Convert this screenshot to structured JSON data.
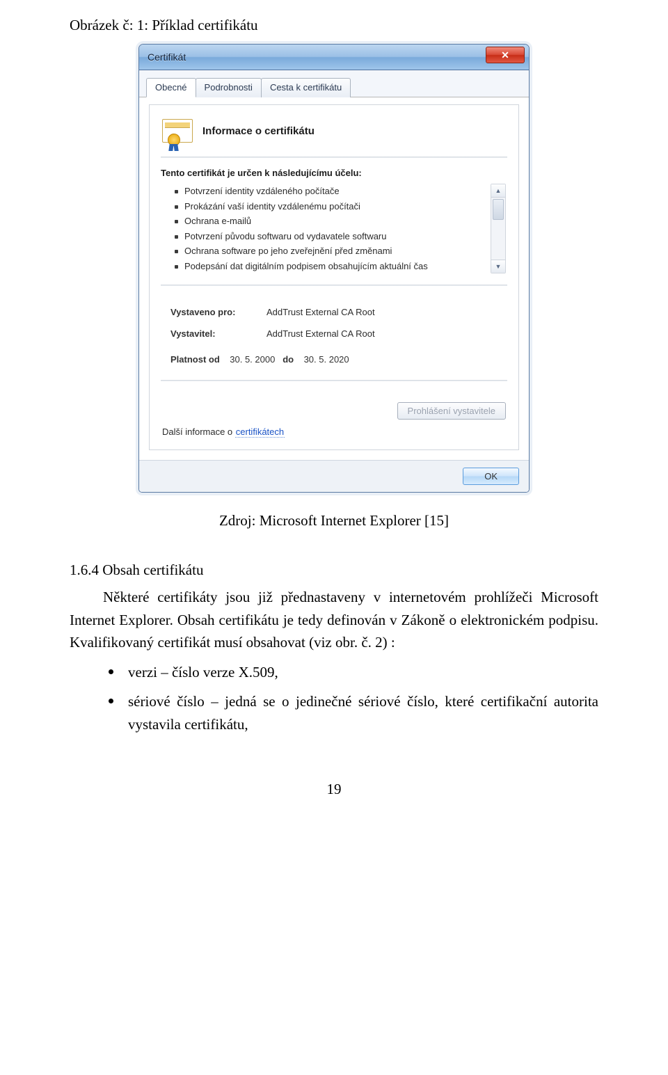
{
  "figure_caption": "Obrázek č: 1: Příklad certifikátu",
  "window": {
    "title": "Certifikát",
    "tabs": [
      "Obecné",
      "Podrobnosti",
      "Cesta k certifikátu"
    ],
    "cert_info_heading": "Informace o certifikátu",
    "purpose_heading": "Tento certifikát je určen k následujícímu účelu:",
    "purposes": [
      "Potvrzení identity vzdáleného počítače",
      "Prokázání vaší identity vzdálenému počítači",
      "Ochrana e-mailů",
      "Potvrzení původu softwaru od vydavatele softwaru",
      "Ochrana software po jeho zveřejnění před změnami",
      "Podepsání dat digitálním podpisem obsahujícím aktuální čas"
    ],
    "issued_to_label": "Vystaveno pro:",
    "issued_to_value": "AddTrust External CA Root",
    "issuer_label": "Vystavitel:",
    "issuer_value": "AddTrust External CA Root",
    "valid_from_label": "Platnost od",
    "valid_from_value": "30. 5. 2000",
    "valid_to_label": "do",
    "valid_to_value": "30. 5. 2020",
    "issuer_statement_btn": "Prohlášení vystavitele",
    "more_info_prefix": "Další informace o ",
    "more_info_link": "certifikátech",
    "ok_btn": "OK"
  },
  "source_line": "Zdroj: Microsoft Internet Explorer [15]",
  "section": {
    "heading": "1.6.4  Obsah certifikátu",
    "paragraph": "Některé certifikáty jsou již přednastaveny v internetovém prohlížeči Microsoft Internet Explorer. Obsah certifikátu je tedy definován v Zákoně o elektronickém podpisu. Kvalifikovaný certifikát musí obsahovat (viz obr. č. 2) :",
    "bullets": [
      "verzi – číslo verze X.509,",
      "sériové číslo – jedná se o jedinečné sériové číslo, které certifikační autorita vystavila certifikátu,"
    ]
  },
  "page_number": "19"
}
